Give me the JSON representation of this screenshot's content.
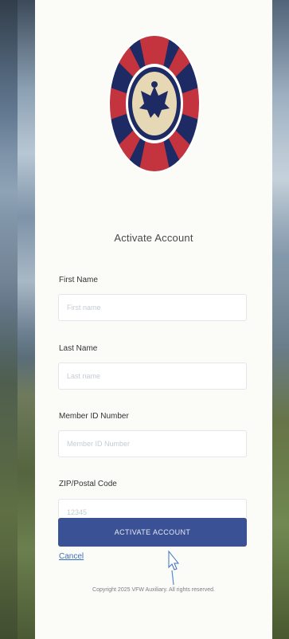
{
  "page": {
    "title": "Activate Account",
    "copyright": "Copyright 2025 VFW Auxiliary. All rights reserved."
  },
  "form": {
    "first_name": {
      "label": "First Name",
      "placeholder": "First name"
    },
    "last_name": {
      "label": "Last Name",
      "placeholder": "Last name"
    },
    "member_id": {
      "label": "Member ID Number",
      "placeholder": "Member ID Number"
    },
    "zip": {
      "label": "ZIP/Postal Code",
      "placeholder": "12345"
    },
    "submit_label": "ACTIVATE ACCOUNT",
    "cancel_label": "Cancel"
  },
  "colors": {
    "primary": "#3a5195",
    "link": "#3a6fc0",
    "logo_red": "#c4343e",
    "logo_navy": "#1e2a63",
    "logo_tan": "#e6d8b4"
  }
}
